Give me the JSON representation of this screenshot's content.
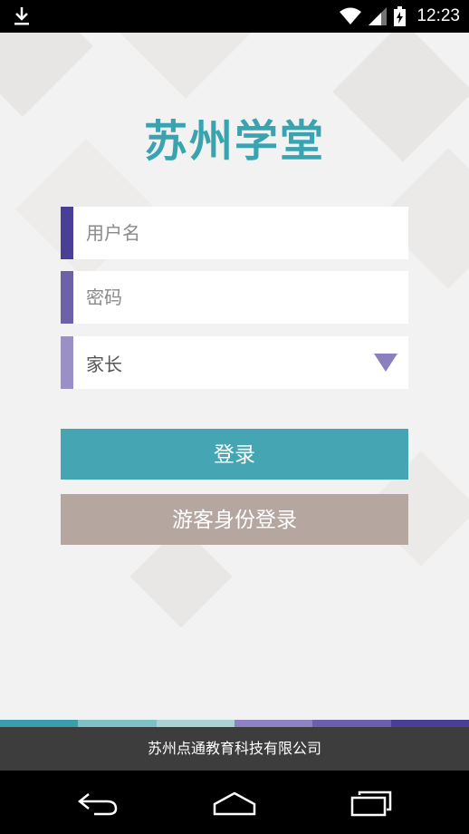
{
  "status_bar": {
    "time": "12:23",
    "icons": [
      "download-icon",
      "wifi-icon",
      "signal-icon",
      "battery-charging-icon"
    ]
  },
  "app": {
    "title": "苏州学堂",
    "username_placeholder": "用户名",
    "password_placeholder": "密码",
    "role_select_value": "家长",
    "login_label": "登录",
    "guest_login_label": "游客身份登录"
  },
  "footer": {
    "company": "苏州点通教育科技有限公司"
  },
  "colors": {
    "title": "#3aa3b0",
    "login_button": "#45a5b2",
    "guest_button": "#b5a69f",
    "accent_username": "#4a3f96",
    "accent_password": "#6d61a8",
    "accent_role": "#9a8fc6",
    "stripe": [
      "#3a9fab",
      "#7ec0c5",
      "#a9d3d4",
      "#8f82c2",
      "#6b5fb0",
      "#4a3f96"
    ]
  },
  "navigation": {
    "icons": [
      "back-icon",
      "home-icon",
      "recent-apps-icon"
    ]
  }
}
